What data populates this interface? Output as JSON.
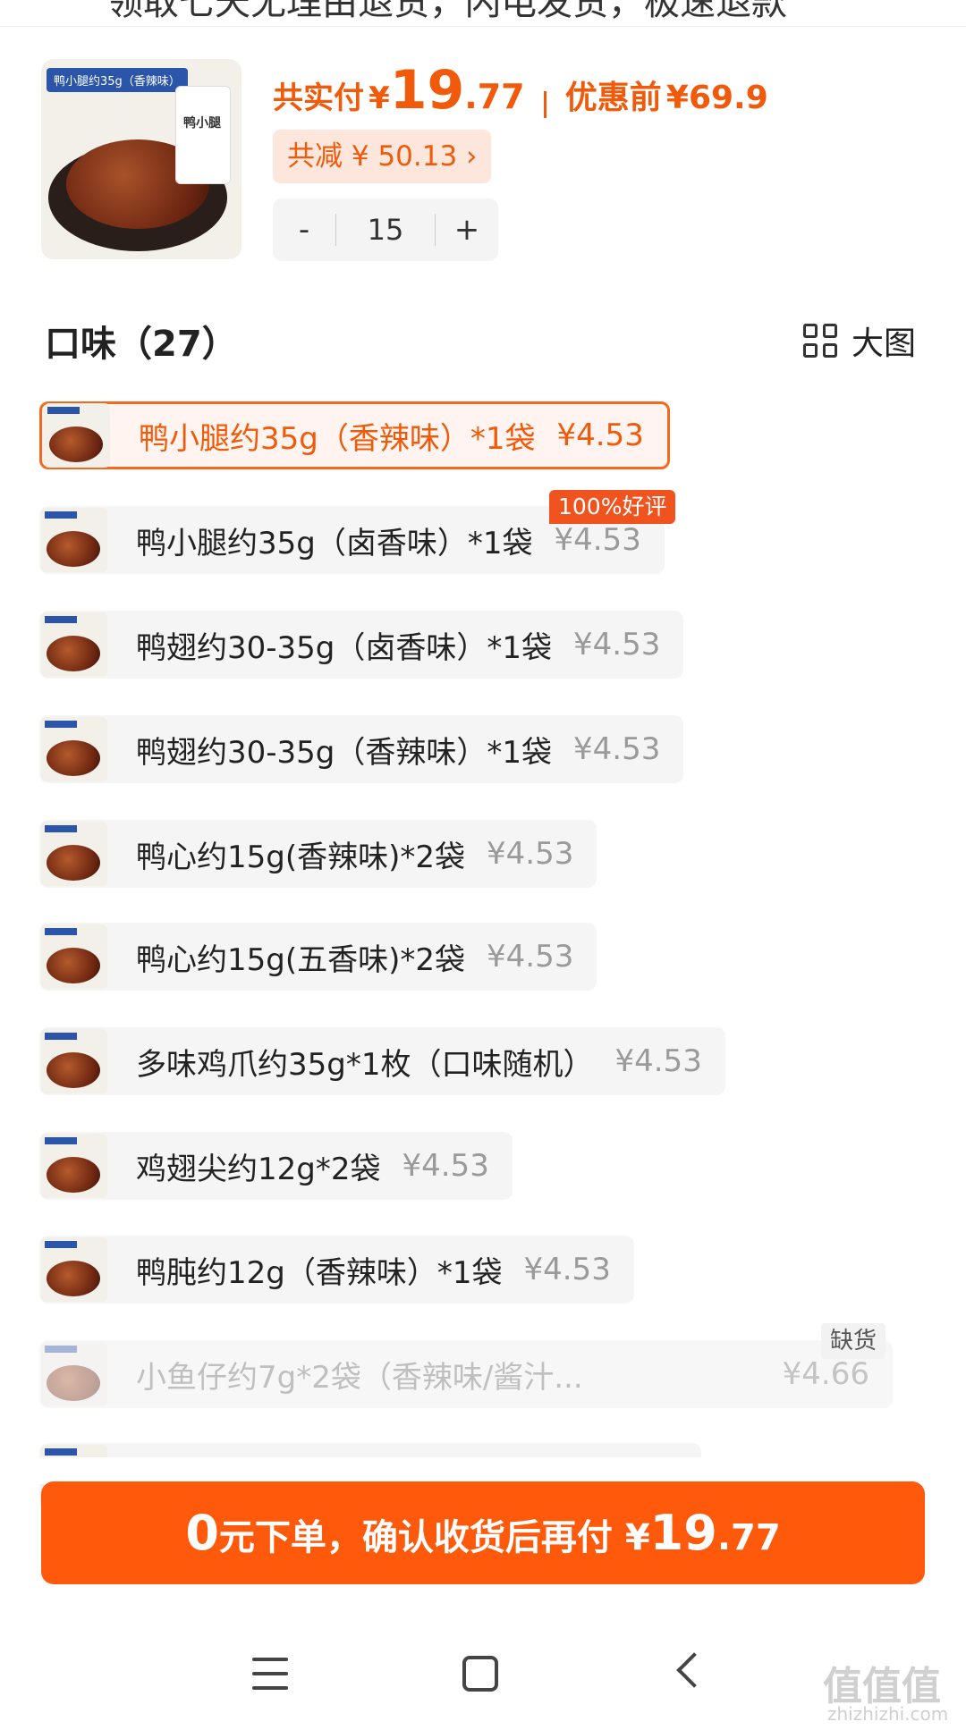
{
  "top_strip_text": "领取七天无理由退货，闪电发货，极速退款",
  "product": {
    "thumb_tag": "鸭小腿约35g（香辣味）",
    "pack_text": "鸭小腿",
    "pay_label": "共实付",
    "currency": "¥",
    "pay_int": "19",
    "pay_dec": ".77",
    "orig_label": "优惠前",
    "orig_price": "¥69.9",
    "discount_text": "共减 ¥ 50.13 ›",
    "quantity": "15",
    "minus": "-",
    "plus": "+"
  },
  "flavor": {
    "title": "口味（27）",
    "big_view_label": "大图"
  },
  "options": [
    {
      "name": "鸭小腿约35g（香辣味）*1袋",
      "price": "¥4.53"
    },
    {
      "name": "鸭小腿约35g（卤香味）*1袋",
      "price": "¥4.53"
    },
    {
      "name": "鸭翅约30-35g（卤香味）*1袋",
      "price": "¥4.53"
    },
    {
      "name": "鸭翅约30-35g（香辣味）*1袋",
      "price": "¥4.53"
    },
    {
      "name": "鸭心约15g(香辣味)*2袋",
      "price": "¥4.53"
    },
    {
      "name": "鸭心约15g(五香味)*2袋",
      "price": "¥4.53"
    },
    {
      "name": "多味鸡爪约35g*1枚（口味随机）",
      "price": "¥4.53"
    },
    {
      "name": "鸡翅尖约12g*2袋",
      "price": "¥4.53"
    },
    {
      "name": "鸭肫约12g（香辣味）*1袋",
      "price": "¥4.53"
    },
    {
      "name": "小鱼仔约7g*2袋（香辣味/酱汁...",
      "price": "¥4.66"
    }
  ],
  "badges": {
    "good_review": "100%好评",
    "out_of_stock": "缺货"
  },
  "cta": {
    "zero": "0",
    "text": "元下单，确认收货后再付 ¥",
    "amount_int": "19",
    "amount_dec": ".77"
  },
  "watermark": {
    "main": "值值值",
    "sub": "zhizhizhi.com"
  },
  "colors": {
    "accent": "#f05a0a",
    "cta": "#ff5a0c",
    "chip_bg": "#fde7dc"
  }
}
